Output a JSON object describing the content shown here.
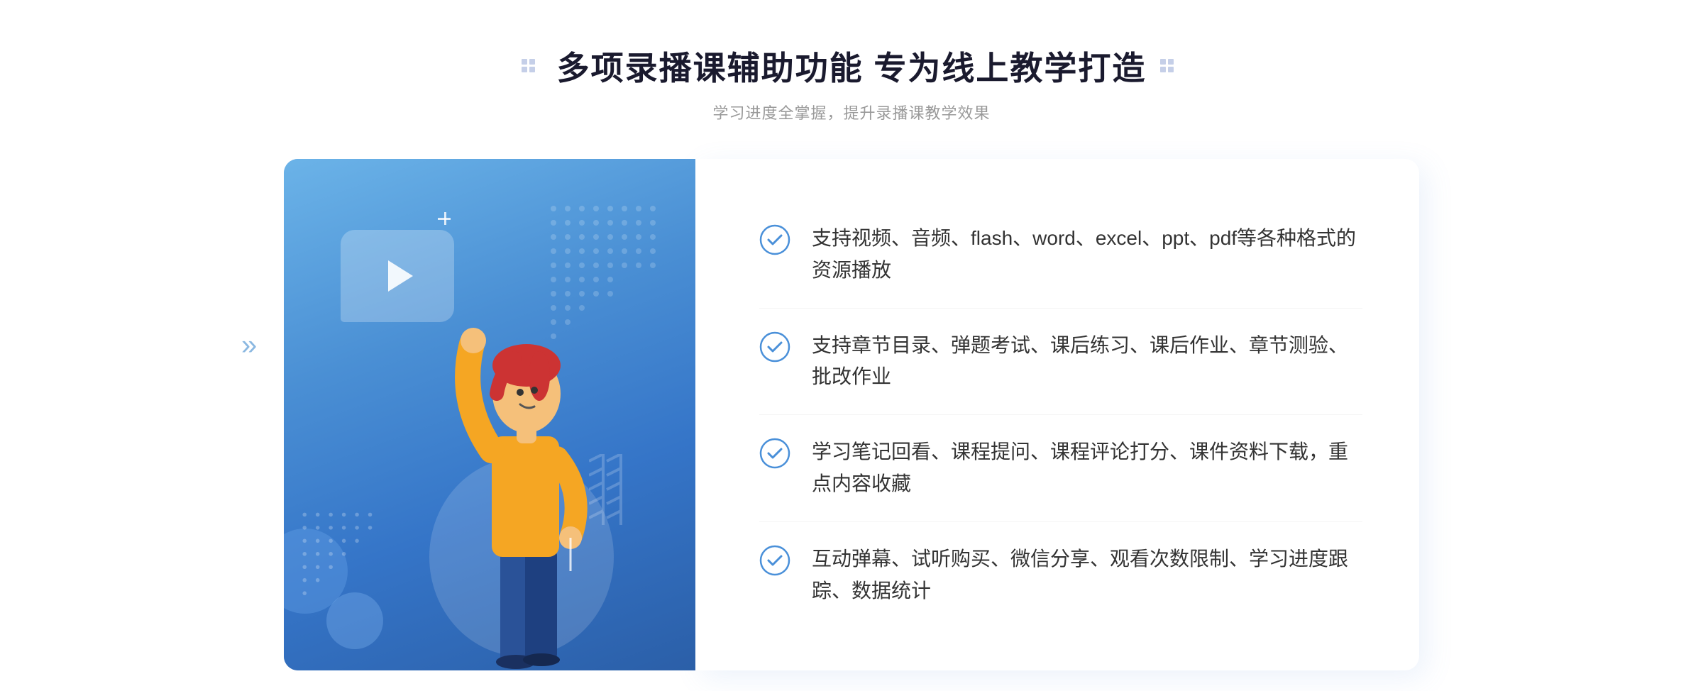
{
  "header": {
    "title": "多项录播课辅助功能 专为线上教学打造",
    "subtitle": "学习进度全掌握，提升录播课教学效果"
  },
  "features": [
    {
      "id": 1,
      "text": "支持视频、音频、flash、word、excel、ppt、pdf等各种格式的资源播放"
    },
    {
      "id": 2,
      "text": "支持章节目录、弹题考试、课后练习、课后作业、章节测验、批改作业"
    },
    {
      "id": 3,
      "text": "学习笔记回看、课程提问、课程评论打分、课件资料下载，重点内容收藏"
    },
    {
      "id": 4,
      "text": "互动弹幕、试听购买、微信分享、观看次数限制、学习进度跟踪、数据统计"
    }
  ],
  "decorators": {
    "left_dots": "⁚",
    "right_dots": "⁚",
    "left_arrows": "»",
    "check_color": "#4a90d9",
    "title_color": "#1a1a2e",
    "subtitle_color": "#999999"
  }
}
